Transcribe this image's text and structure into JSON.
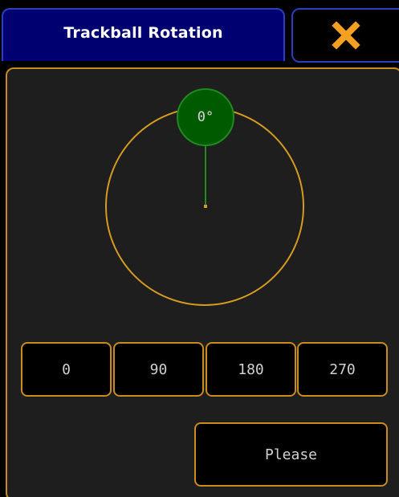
{
  "dialog": {
    "title": "Trackball Rotation",
    "close_icon": "close-x-icon",
    "colors": {
      "title_background": "#000070",
      "accent_orange": "#c98a1e",
      "close_x": "#f4a020",
      "knob_green": "#005a00",
      "panel_background": "#1e1e1e"
    }
  },
  "dial": {
    "angle_label": "0°",
    "angle_value": 0
  },
  "presets": [
    {
      "label": "0"
    },
    {
      "label": "90"
    },
    {
      "label": "180"
    },
    {
      "label": "270"
    }
  ],
  "actions": {
    "please_label": "Please"
  }
}
